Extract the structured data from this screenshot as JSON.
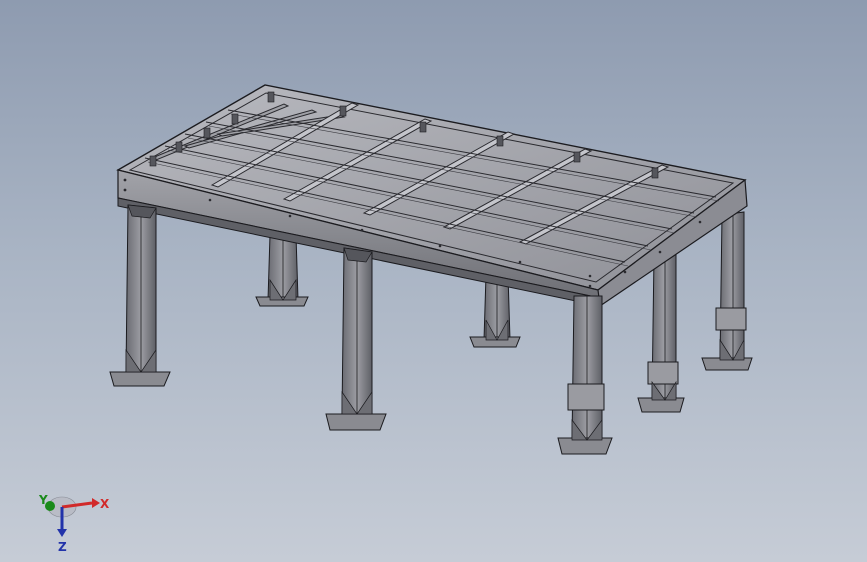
{
  "viewport": {
    "background_top": "#8e9bb0",
    "background_bottom": "#c6ccd6"
  },
  "model": {
    "part_color": "#7d7f86",
    "part_light": "#b3b4ba",
    "part_dark": "#55565c",
    "edge_color": "#1b1b1f"
  },
  "triad": {
    "x_label": "X",
    "y_label": "Y",
    "z_label": "Z",
    "x_color": "#d12a2a",
    "y_color": "#1a8a1a",
    "z_color": "#2233aa"
  }
}
